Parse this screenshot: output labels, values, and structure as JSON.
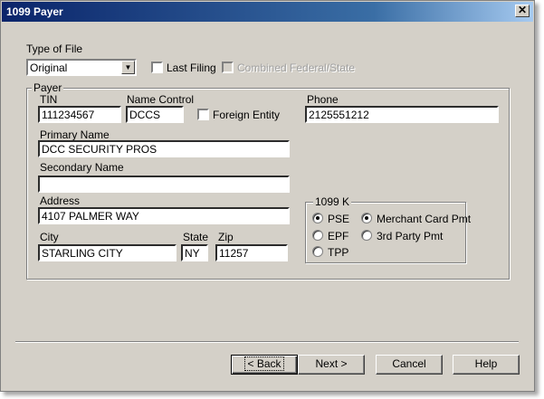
{
  "window": {
    "title": "1099 Payer"
  },
  "type_of_file": {
    "label": "Type of File",
    "selected": "Original"
  },
  "last_filing": {
    "label": "Last Filing",
    "checked": false
  },
  "combined": {
    "label": "Combined Federal/State",
    "checked": false,
    "enabled": false
  },
  "payer": {
    "group_label": "Payer",
    "tin": {
      "label": "TIN",
      "value": "111234567"
    },
    "name_control": {
      "label": "Name Control",
      "value": "DCCS"
    },
    "foreign_entity": {
      "label": "Foreign Entity",
      "checked": false
    },
    "phone": {
      "label": "Phone",
      "value": "2125551212"
    },
    "primary_name": {
      "label": "Primary Name",
      "value": "DCC SECURITY PROS"
    },
    "secondary_name": {
      "label": "Secondary Name",
      "value": ""
    },
    "address": {
      "label": "Address",
      "value": "4107 PALMER WAY"
    },
    "city": {
      "label": "City",
      "value": "STARLING CITY"
    },
    "state": {
      "label": "State",
      "value": "NY"
    },
    "zip": {
      "label": "Zip",
      "value": "11257"
    }
  },
  "k1099": {
    "group_label": "1099 K",
    "options_left": [
      {
        "label": "PSE",
        "selected": true
      },
      {
        "label": "EPF",
        "selected": false
      },
      {
        "label": "TPP",
        "selected": false
      }
    ],
    "options_right": [
      {
        "label": "Merchant Card Pmt",
        "selected": true
      },
      {
        "label": "3rd Party Pmt",
        "selected": false
      }
    ]
  },
  "buttons": {
    "back": "< Back",
    "next": "Next >",
    "cancel": "Cancel",
    "help": "Help"
  }
}
